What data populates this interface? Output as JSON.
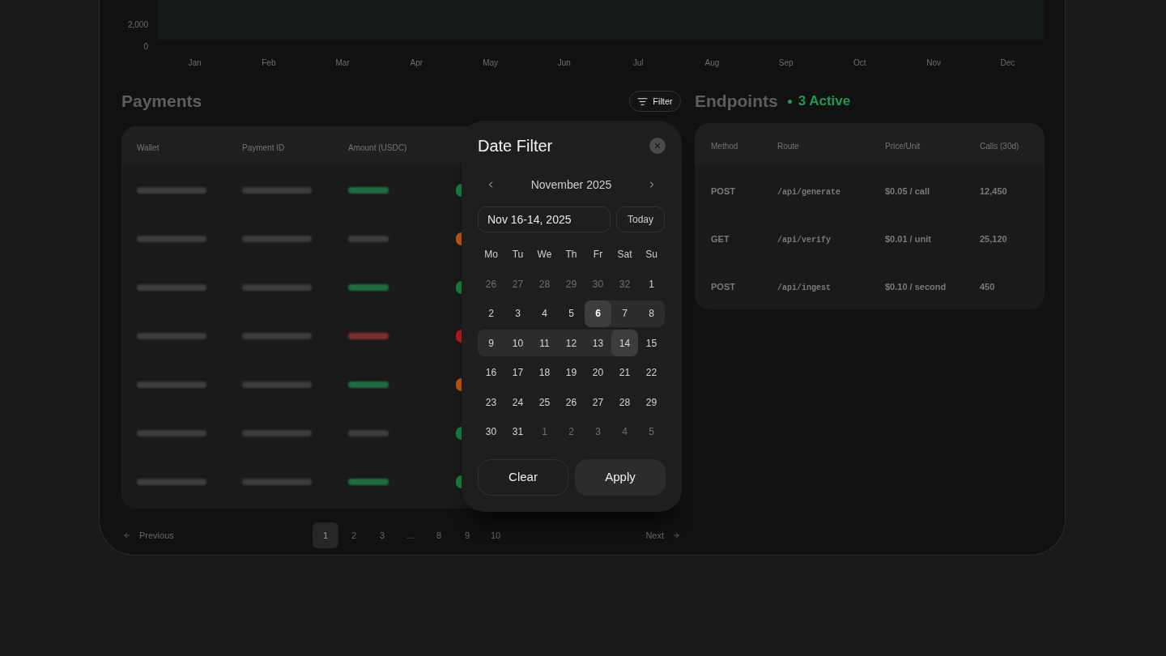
{
  "revenue_chart": {
    "y_labels": [
      "2,000",
      "0"
    ],
    "x_labels": [
      "Jan",
      "Feb",
      "Mar",
      "Apr",
      "May",
      "Jun",
      "Jul",
      "Aug",
      "Sep",
      "Oct",
      "Nov",
      "Dec"
    ]
  },
  "payments": {
    "title": "Payments",
    "filter_button": "Filter",
    "columns": [
      "Wallet",
      "Payment ID",
      "Amount (USDC)"
    ],
    "rows": [
      {
        "kind": "credit",
        "color": "#15803d"
      },
      {
        "kind": "neutral",
        "color": "#c2570c"
      },
      {
        "kind": "credit",
        "color": "#15803d"
      },
      {
        "kind": "debit",
        "color": "#b91c1c"
      },
      {
        "kind": "credit",
        "color": "#c2570c"
      },
      {
        "kind": "neutral",
        "color": "#15803d"
      },
      {
        "kind": "credit",
        "color": "#15803d"
      }
    ]
  },
  "pagination": {
    "previous": "Previous",
    "pages": [
      {
        "label": "1",
        "kind": "page",
        "selected": true
      },
      {
        "label": "2",
        "kind": "page",
        "selected": false
      },
      {
        "label": "3",
        "kind": "page",
        "selected": false
      },
      {
        "label": "...",
        "kind": "ellipsis"
      },
      {
        "label": "8",
        "kind": "page",
        "selected": false
      },
      {
        "label": "9",
        "kind": "page",
        "selected": false
      },
      {
        "label": "10",
        "kind": "page",
        "selected": false
      }
    ],
    "next": "Next"
  },
  "endpoints": {
    "title": "Endpoints",
    "active_badge": "3 Active",
    "columns": [
      "Method",
      "Route",
      "Price/Unit",
      "Calls (30d)"
    ],
    "rows": [
      {
        "method": "POST",
        "route": "/api/generate",
        "price": "$0.05 / call",
        "calls": "12,450"
      },
      {
        "method": "GET",
        "route": "/api/verify",
        "price": "$0.01 / unit",
        "calls": "25,120"
      },
      {
        "method": "POST",
        "route": "/api/ingest",
        "price": "$0.10 / second",
        "calls": "450"
      }
    ]
  },
  "date_filter": {
    "title": "Date Filter",
    "month": "November 2025",
    "range_input": {
      "value": "Nov 16-14, 2025"
    },
    "today_button": "Today",
    "weekdays": [
      "Mo",
      "Tu",
      "We",
      "Th",
      "Fr",
      "Sat",
      "Su"
    ],
    "weeks": [
      [
        {
          "label": "26",
          "muted": true,
          "selected": false,
          "in_range": false,
          "today": false
        },
        {
          "label": "27",
          "muted": true,
          "selected": false,
          "in_range": false,
          "today": false
        },
        {
          "label": "28",
          "muted": true,
          "selected": false,
          "in_range": false,
          "today": false
        },
        {
          "label": "29",
          "muted": true,
          "selected": false,
          "in_range": false,
          "today": false
        },
        {
          "label": "30",
          "muted": true,
          "selected": false,
          "in_range": false,
          "today": false
        },
        {
          "label": "32",
          "muted": true,
          "selected": false,
          "in_range": false,
          "today": false
        },
        {
          "label": "1",
          "muted": false,
          "selected": false,
          "in_range": false,
          "today": false
        }
      ],
      [
        {
          "label": "2",
          "muted": false,
          "selected": false,
          "in_range": false,
          "today": false
        },
        {
          "label": "3",
          "muted": false,
          "selected": false,
          "in_range": false,
          "today": false
        },
        {
          "label": "4",
          "muted": false,
          "selected": false,
          "in_range": false,
          "today": false
        },
        {
          "label": "5",
          "muted": false,
          "selected": false,
          "in_range": false,
          "today": false
        },
        {
          "label": "6",
          "muted": false,
          "selected": true,
          "in_range": true,
          "today": true
        },
        {
          "label": "7",
          "muted": false,
          "selected": false,
          "in_range": true,
          "today": false
        },
        {
          "label": "8",
          "muted": false,
          "selected": false,
          "in_range": true,
          "today": false
        }
      ],
      [
        {
          "label": "9",
          "muted": false,
          "selected": false,
          "in_range": true,
          "today": false
        },
        {
          "label": "10",
          "muted": false,
          "selected": false,
          "in_range": true,
          "today": false
        },
        {
          "label": "11",
          "muted": false,
          "selected": false,
          "in_range": true,
          "today": false
        },
        {
          "label": "12",
          "muted": false,
          "selected": false,
          "in_range": true,
          "today": false
        },
        {
          "label": "13",
          "muted": false,
          "selected": false,
          "in_range": true,
          "today": false
        },
        {
          "label": "14",
          "muted": false,
          "selected": true,
          "in_range": true,
          "today": false
        },
        {
          "label": "15",
          "muted": false,
          "selected": false,
          "in_range": false,
          "today": false
        }
      ],
      [
        {
          "label": "16",
          "muted": false,
          "selected": false,
          "in_range": false,
          "today": false
        },
        {
          "label": "17",
          "muted": false,
          "selected": false,
          "in_range": false,
          "today": false
        },
        {
          "label": "18",
          "muted": false,
          "selected": false,
          "in_range": false,
          "today": false
        },
        {
          "label": "19",
          "muted": false,
          "selected": false,
          "in_range": false,
          "today": false
        },
        {
          "label": "20",
          "muted": false,
          "selected": false,
          "in_range": false,
          "today": false
        },
        {
          "label": "21",
          "muted": false,
          "selected": false,
          "in_range": false,
          "today": false
        },
        {
          "label": "22",
          "muted": false,
          "selected": false,
          "in_range": false,
          "today": false
        }
      ],
      [
        {
          "label": "23",
          "muted": false,
          "selected": false,
          "in_range": false,
          "today": false
        },
        {
          "label": "24",
          "muted": false,
          "selected": false,
          "in_range": false,
          "today": false
        },
        {
          "label": "25",
          "muted": false,
          "selected": false,
          "in_range": false,
          "today": false
        },
        {
          "label": "26",
          "muted": false,
          "selected": false,
          "in_range": false,
          "today": false
        },
        {
          "label": "27",
          "muted": false,
          "selected": false,
          "in_range": false,
          "today": false
        },
        {
          "label": "28",
          "muted": false,
          "selected": false,
          "in_range": false,
          "today": false
        },
        {
          "label": "29",
          "muted": false,
          "selected": false,
          "in_range": false,
          "today": false
        }
      ],
      [
        {
          "label": "30",
          "muted": false,
          "selected": false,
          "in_range": false,
          "today": false
        },
        {
          "label": "31",
          "muted": false,
          "selected": false,
          "in_range": false,
          "today": false
        },
        {
          "label": "1",
          "muted": true,
          "selected": false,
          "in_range": false,
          "today": false
        },
        {
          "label": "2",
          "muted": true,
          "selected": false,
          "in_range": false,
          "today": false
        },
        {
          "label": "3",
          "muted": true,
          "selected": false,
          "in_range": false,
          "today": false
        },
        {
          "label": "4",
          "muted": true,
          "selected": false,
          "in_range": false,
          "today": false
        },
        {
          "label": "5",
          "muted": true,
          "selected": false,
          "in_range": false,
          "today": false
        }
      ]
    ],
    "buttons": [
      {
        "label": "Clear",
        "kind": "outline"
      },
      {
        "label": "Apply",
        "kind": "filled"
      }
    ]
  }
}
